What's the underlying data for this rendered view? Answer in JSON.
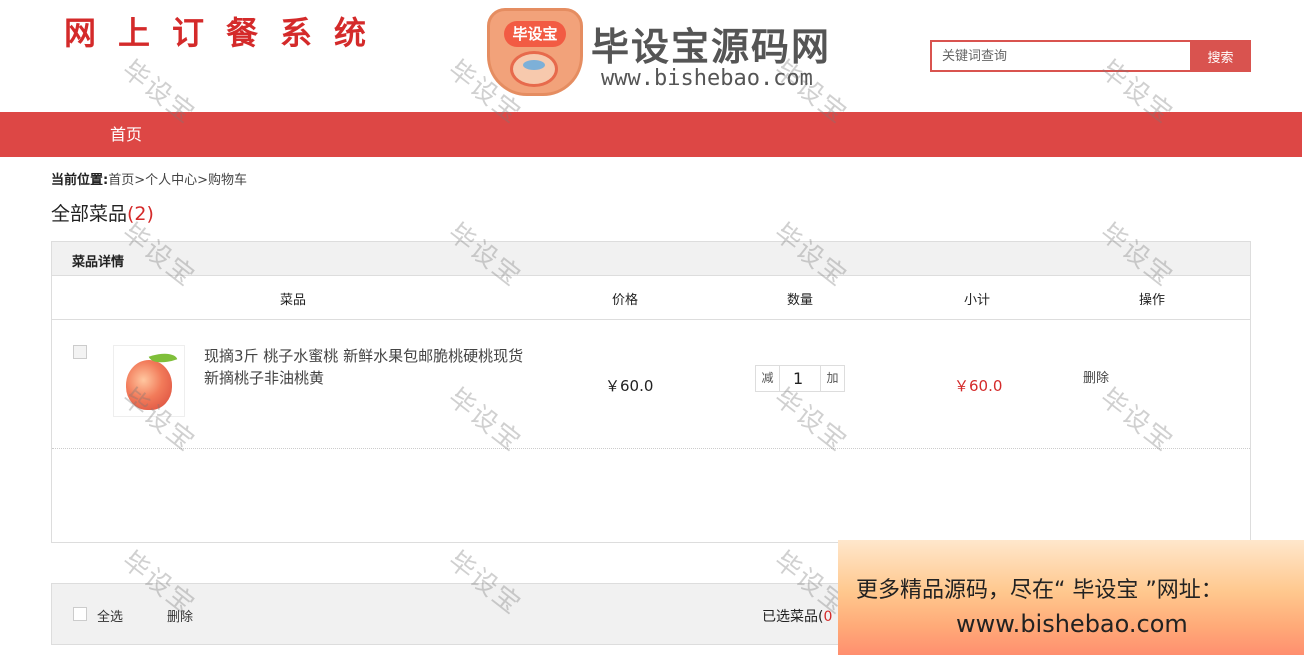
{
  "site": {
    "title": "网上订餐系统",
    "logo_name": "毕设宝源码网",
    "logo_badge": "毕设宝",
    "logo_url": "www.bishebao.com"
  },
  "search": {
    "placeholder": "关键词查询",
    "button": "搜索"
  },
  "nav": {
    "items": [
      {
        "label": "首页"
      }
    ]
  },
  "breadcrumb": {
    "label": "当前位置:",
    "items": [
      "首页",
      "个人中心",
      "购物车"
    ],
    "separator": ">"
  },
  "section": {
    "title": "全部菜品",
    "count": "(2)"
  },
  "cart": {
    "header": "菜品详情",
    "columns": [
      "菜品",
      "价格",
      "数量",
      "小计",
      "操作"
    ],
    "items": [
      {
        "name": "现摘3斤 桃子水蜜桃 新鲜水果包邮脆桃硬桃现货新摘桃子非油桃黄",
        "price": "￥60.0",
        "qty_minus": "减",
        "quantity": "1",
        "qty_plus": "加",
        "subtotal": "￥60.0",
        "action": "删除"
      }
    ]
  },
  "footer": {
    "select_all": "全选",
    "delete": "删除",
    "selected_label": "已选菜品(",
    "selected_count": "0"
  },
  "watermark": "毕设宝",
  "promo": {
    "line1": "更多精品源码，尽在“ 毕设宝 ”网址：",
    "line2": "www.bishebao.com"
  },
  "colors": {
    "accent": "#dd4745",
    "price_red": "#d42a2a"
  }
}
